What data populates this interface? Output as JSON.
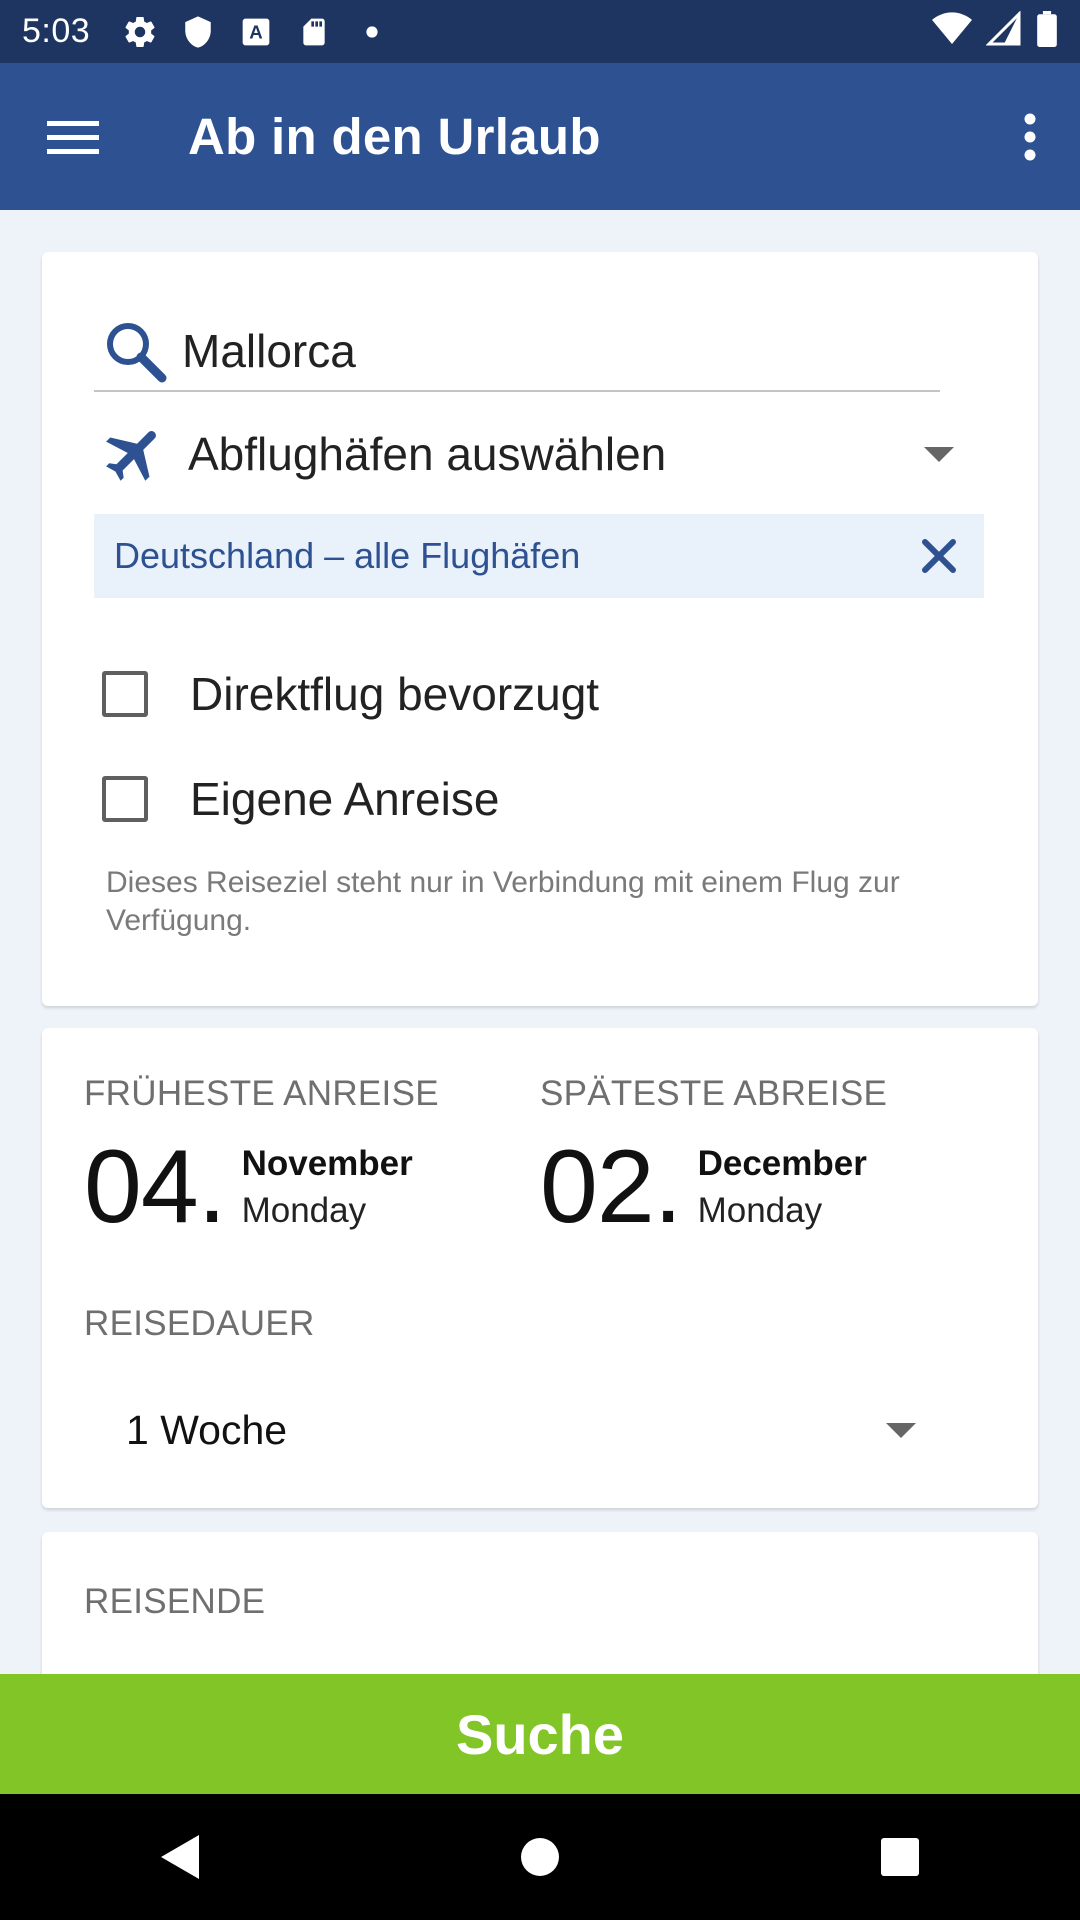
{
  "status_bar": {
    "time": "5:03",
    "icons": [
      "gear-icon",
      "shield-icon",
      "a-icon",
      "sd-card-icon",
      "dot-icon"
    ],
    "right_icons": [
      "wifi-icon",
      "signal-icon",
      "battery-icon"
    ]
  },
  "app_bar": {
    "title": "Ab in den Urlaub",
    "menu_icon": "hamburger-menu-icon",
    "more_icon": "more-vert-icon"
  },
  "search": {
    "value": "Mallorca",
    "icon": "search-icon"
  },
  "airports": {
    "label": "Abflughäfen auswählen",
    "icon": "airplane-icon",
    "selected_chip": "Deutschland  – alle Flughäfen"
  },
  "options": {
    "direct_flight": {
      "label": "Direktflug bevorzugt",
      "checked": false
    },
    "own_arrival": {
      "label": "Eigene Anreise",
      "checked": false
    },
    "hint": "Dieses Reiseziel steht nur in Verbindung mit einem Flug zur Verfügung."
  },
  "dates": {
    "earliest": {
      "label": "FRÜHESTE ANREISE",
      "day": "04.",
      "month": "November",
      "weekday": "Monday"
    },
    "latest": {
      "label": "SPÄTESTE ABREISE",
      "day": "02.",
      "month": "December",
      "weekday": "Monday"
    }
  },
  "duration": {
    "label": "REISEDAUER",
    "value": "1 Woche"
  },
  "travelers": {
    "label": "REISENDE"
  },
  "search_button": {
    "label": "Suche"
  },
  "colors": {
    "status_bar": "#1f3561",
    "app_bar": "#2d5191",
    "accent": "#2d5191",
    "chip_bg": "#e9f1fb",
    "search_button": "#82c526"
  }
}
